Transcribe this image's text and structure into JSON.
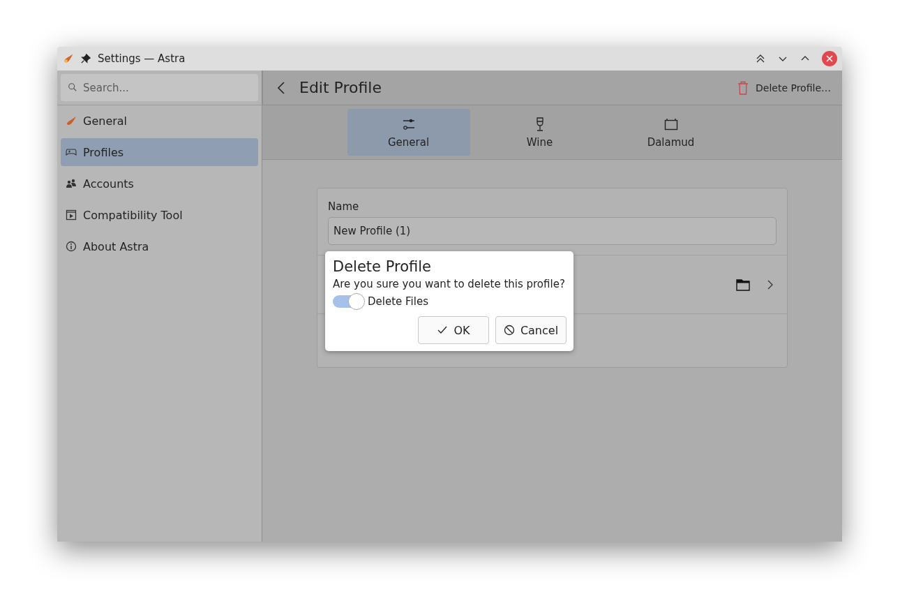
{
  "window": {
    "title": "Settings — Astra"
  },
  "sidebar": {
    "search": {
      "placeholder": "Search..."
    },
    "items": [
      {
        "label": "General",
        "selected": false
      },
      {
        "label": "Profiles",
        "selected": true
      },
      {
        "label": "Accounts",
        "selected": false
      },
      {
        "label": "Compatibility Tool",
        "selected": false
      },
      {
        "label": "About Astra",
        "selected": false
      }
    ]
  },
  "header": {
    "title": "Edit Profile",
    "delete_action": "Delete Profile…"
  },
  "tabs": [
    {
      "label": "General",
      "selected": true
    },
    {
      "label": "Wine",
      "selected": false
    },
    {
      "label": "Dalamud",
      "selected": false
    }
  ],
  "form": {
    "name_label": "Name",
    "name_value": "New Profile (1)"
  },
  "dialog": {
    "title": "Delete Profile",
    "message": "Are you sure you want to delete this profile?",
    "toggle": {
      "label": "Delete Files",
      "on": true
    },
    "buttons": [
      "OK",
      "Cancel"
    ]
  }
}
